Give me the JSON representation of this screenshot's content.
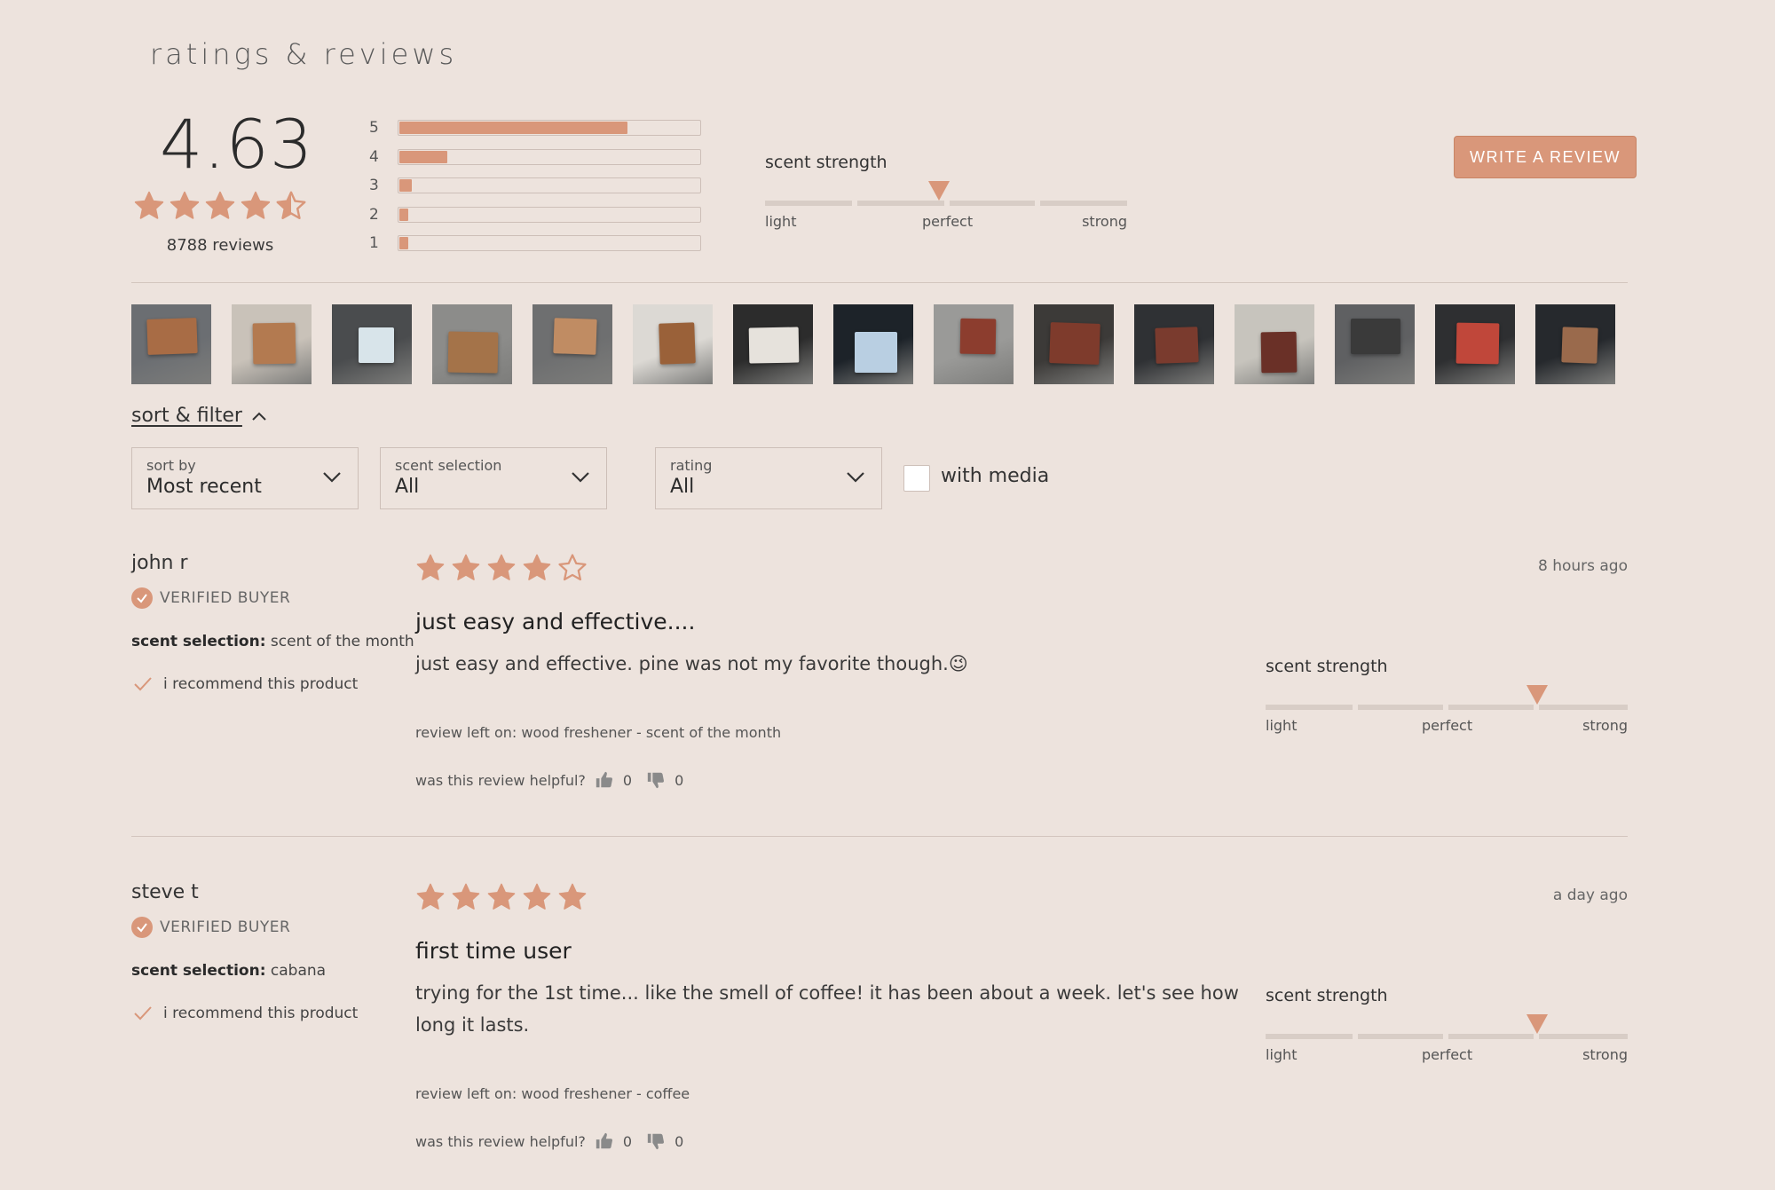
{
  "section_title": "ratings & reviews",
  "summary": {
    "average": "4.63",
    "review_count": "8788 reviews",
    "rating_value": 4.63,
    "distribution": [
      {
        "label": "5",
        "fraction": 0.76
      },
      {
        "label": "4",
        "fraction": 0.16
      },
      {
        "label": "3",
        "fraction": 0.04
      },
      {
        "label": "2",
        "fraction": 0.02
      },
      {
        "label": "1",
        "fraction": 0.02
      }
    ],
    "scent_strength": {
      "title": "scent strength",
      "labels": [
        "light",
        "perfect",
        "strong"
      ],
      "value": 0.48
    }
  },
  "write_review_label": "WRITE A REVIEW",
  "thumbnails": [
    {
      "name": "review-photo-1"
    },
    {
      "name": "review-photo-2"
    },
    {
      "name": "review-photo-3"
    },
    {
      "name": "review-photo-4"
    },
    {
      "name": "review-photo-5"
    },
    {
      "name": "review-photo-6"
    },
    {
      "name": "review-photo-7"
    },
    {
      "name": "review-photo-8"
    },
    {
      "name": "review-photo-9"
    },
    {
      "name": "review-photo-10"
    },
    {
      "name": "review-photo-11"
    },
    {
      "name": "review-photo-12"
    },
    {
      "name": "review-photo-13"
    },
    {
      "name": "review-photo-14"
    },
    {
      "name": "review-photo-15"
    }
  ],
  "sort_filter": {
    "link": "sort & filter",
    "sort_by": {
      "label": "sort by",
      "value": "Most recent"
    },
    "scent_selection": {
      "label": "scent selection",
      "value": "All"
    },
    "rating": {
      "label": "rating",
      "value": "All"
    },
    "with_media": "with media"
  },
  "colors": {
    "accent": "#d9977a",
    "background": "#ede3dd",
    "track": "#d8cdc6"
  },
  "reviews": [
    {
      "name": "john r",
      "verified": "VERIFIED BUYER",
      "scent_label": "scent selection:",
      "scent_value": "scent of the month",
      "recommend": "i recommend this product",
      "stars": 4,
      "title": "just easy and effective....",
      "body": "just easy and effective. pine was not my favorite though.😉",
      "review_left": "review left on: wood freshener - scent of the month",
      "helpful": "was this review helpful?",
      "up": "0",
      "down": "0",
      "time": "8 hours ago",
      "scent_title": "scent strength",
      "scent_labels": [
        "light",
        "perfect",
        "strong"
      ],
      "scent_value_level": 0.75
    },
    {
      "name": "steve t",
      "verified": "VERIFIED BUYER",
      "scent_label": "scent selection:",
      "scent_value": "cabana",
      "recommend": "i recommend this product",
      "stars": 5,
      "title": "first time user",
      "body": "trying for the 1st time... like the smell of coffee! it has been about a week. let's see how long it lasts.",
      "review_left": "review left on: wood freshener - coffee",
      "helpful": "was this review helpful?",
      "up": "0",
      "down": "0",
      "time": "a day ago",
      "scent_title": "scent strength",
      "scent_labels": [
        "light",
        "perfect",
        "strong"
      ],
      "scent_value_level": 0.75
    }
  ]
}
